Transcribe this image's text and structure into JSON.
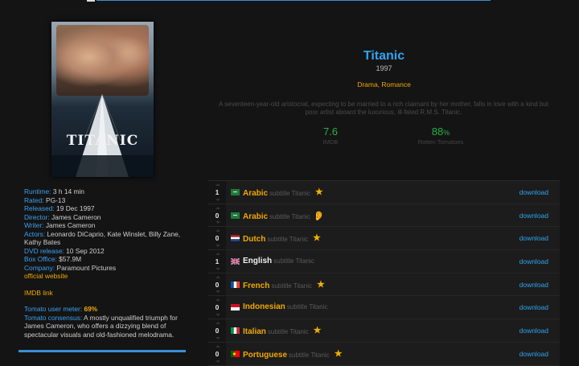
{
  "movie": {
    "title": "Titanic",
    "year": "1997",
    "genres": "Drama, Romance",
    "plot": "A seventeen-year-old aristocrat, expecting to be married to a rich claimant by her mother, falls in love with a kind but poor artist aboard the luxurious, ill-fated R.M.S. Titanic.",
    "poster_title": "TITANIC",
    "imdb_rating": "7.6",
    "imdb_label": "IMDB",
    "tomato_rating": "88",
    "tomato_unit": "%",
    "tomato_label": "Rotten Tomatoes"
  },
  "info": {
    "runtime_label": "Runtime:",
    "runtime": "3 h 14 min",
    "rated_label": "Rated:",
    "rated": "PG-13",
    "released_label": "Released:",
    "released": "19 Dec 1997",
    "director_label": "Director:",
    "director": "James Cameron",
    "writer_label": "Writer:",
    "writer": "James Cameron",
    "actors_label": "Actors:",
    "actors": "Leonardo DiCaprio, Kate Winslet, Billy Zane, Kathy Bates",
    "dvd_label": "DVD release:",
    "dvd": "10 Sep 2012",
    "boxoffice_label": "Box Office:",
    "boxoffice": "$57.9M",
    "company_label": "Company:",
    "company": "Paramount Pictures",
    "official_website": "official website",
    "imdb_link": "IMDB link",
    "tomato_meter_label": "Tomato user meter:",
    "tomato_meter": "69%",
    "tomato_consensus_label": "Tomato consensus:",
    "tomato_consensus": "A mostly unqualified triumph for James Cameron, who offers a dizzying blend of spectacular visuals and old-fashioned melodrama."
  },
  "subtitles": [
    {
      "votes": "1",
      "language": "Arabic",
      "label": "subtitle Titanic",
      "badge": "star",
      "download": "download",
      "flag": "sa"
    },
    {
      "votes": "0",
      "language": "Arabic",
      "label": "subtitle Titanic",
      "badge": "hearing",
      "download": "download",
      "flag": "sa"
    },
    {
      "votes": "0",
      "language": "Dutch",
      "label": "subtitle Titanic",
      "badge": "star",
      "download": "download",
      "flag": "nl"
    },
    {
      "votes": "1",
      "language": "English",
      "label": "subtitle Titanic",
      "badge": "",
      "download": "download",
      "flag": "gb"
    },
    {
      "votes": "0",
      "language": "French",
      "label": "subtitle Titanic",
      "badge": "star",
      "download": "download",
      "flag": "fr"
    },
    {
      "votes": "0",
      "language": "Indonesian",
      "label": "subtitle Titanic",
      "badge": "",
      "download": "download",
      "flag": "id"
    },
    {
      "votes": "0",
      "language": "Italian",
      "label": "subtitle Titanic",
      "badge": "star",
      "download": "download",
      "flag": "it"
    },
    {
      "votes": "0",
      "language": "Portuguese",
      "label": "subtitle Titanic",
      "badge": "star",
      "download": "download",
      "flag": "pt"
    }
  ],
  "colors": {
    "accent": "#2fa4f0",
    "highlight": "#f0a800",
    "rating": "#26b14a",
    "background": "#141414"
  }
}
